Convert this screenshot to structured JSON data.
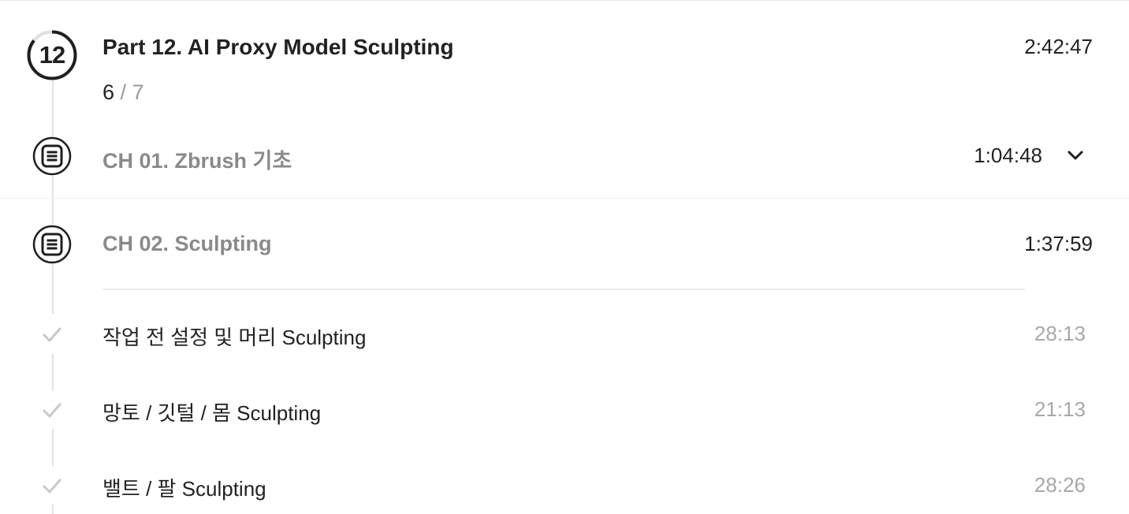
{
  "part": {
    "number": "12",
    "title": "Part 12. AI Proxy Model Sculpting",
    "duration": "2:42:47",
    "progress_completed": "6",
    "progress_separator": "/",
    "progress_total": "7",
    "progress_fraction": 0.857
  },
  "chapters": [
    {
      "title": "CH 01. Zbrush 기초",
      "duration": "1:04:48",
      "icon": "document-list-icon",
      "collapsed_toggle": "chevron-down-icon"
    },
    {
      "title": "CH 02. Sculpting",
      "duration": "1:37:59",
      "icon": "document-list-icon"
    }
  ],
  "lessons": [
    {
      "title": "작업 전 설정 및 머리 Sculpting",
      "duration": "28:13",
      "status_icon": "check-icon"
    },
    {
      "title": "망토 / 깃털 / 몸 Sculpting",
      "duration": "21:13",
      "status_icon": "check-icon"
    },
    {
      "title": "밸트 / 팔 Sculpting",
      "duration": "28:26",
      "status_icon": "check-icon"
    }
  ],
  "colors": {
    "text_primary": "#222222",
    "text_muted": "#8a8a8a",
    "duration_muted": "#a8a8a8",
    "check": "#c8c8c8",
    "timeline": "#e3e3e3"
  }
}
